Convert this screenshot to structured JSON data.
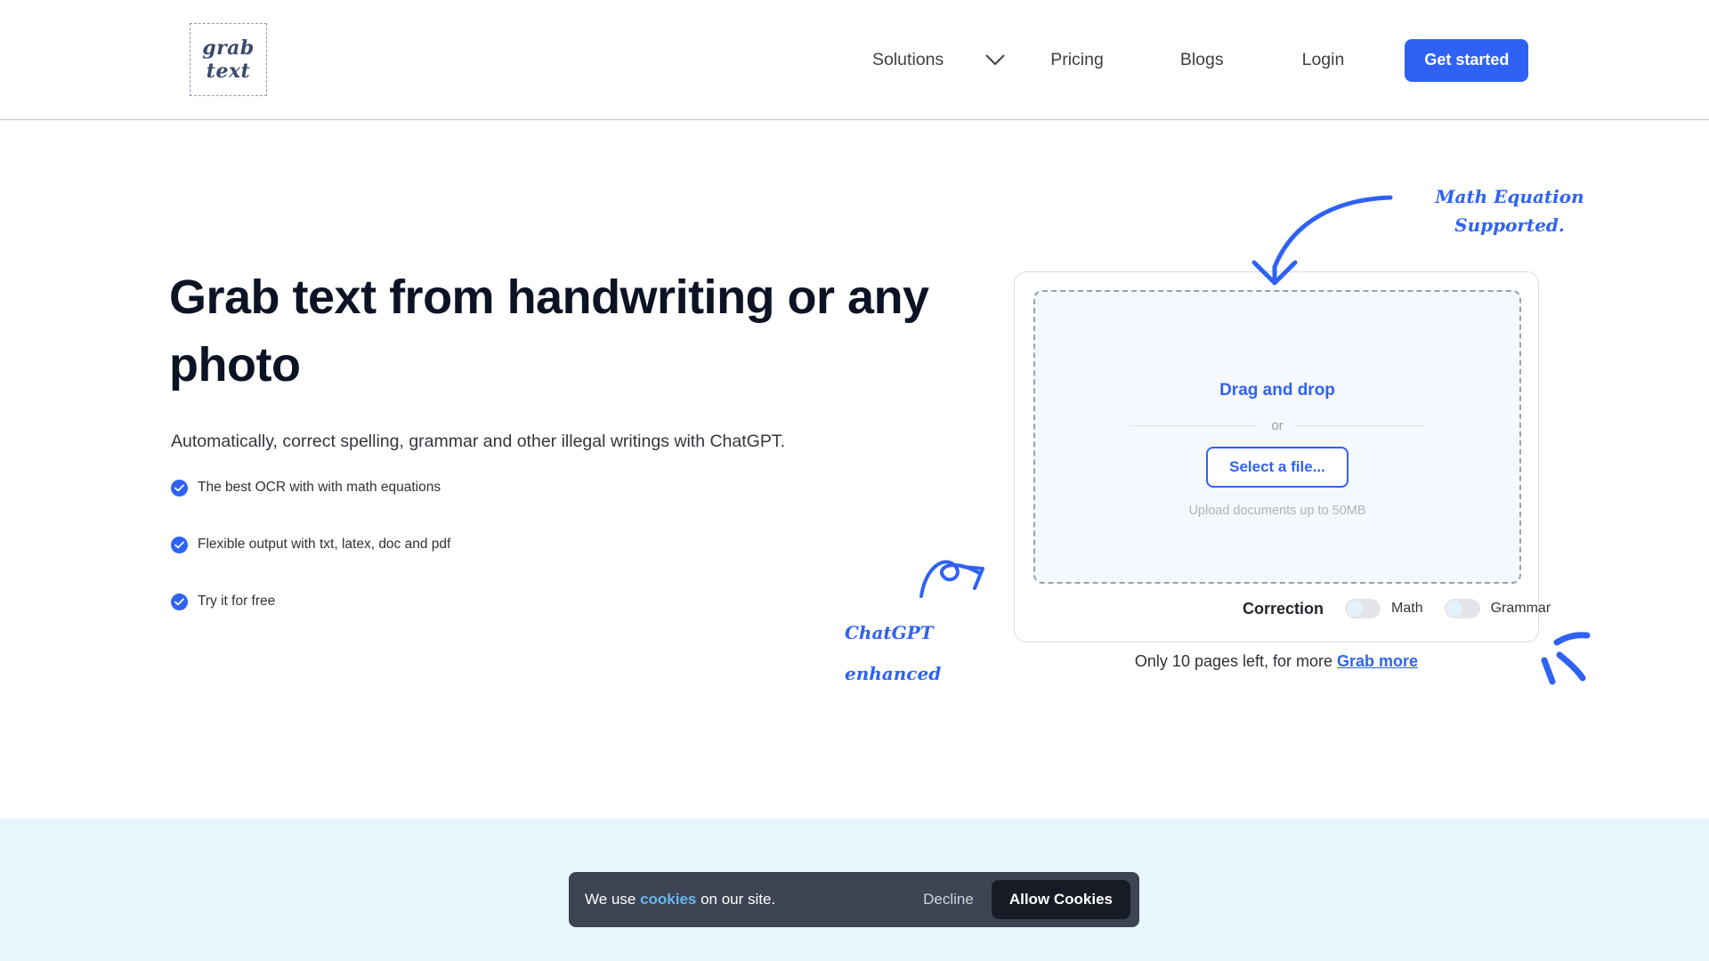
{
  "brand": {
    "logo_line1": "grab",
    "logo_line2": "text",
    "accent_blue": "#2f62f4",
    "logo_navy": "#3b4a6b"
  },
  "header": {
    "nav": {
      "solutions": "Solutions",
      "chevron_icon": "chevron-down-icon",
      "pricing": "Pricing",
      "blogs": "Blogs",
      "login": "Login"
    },
    "cta": "Get started"
  },
  "hero": {
    "title": "Grab text from handwriting or any photo",
    "subtitle": "Automatically, correct spelling, grammar and other illegal writings with ChatGPT.",
    "bullets": [
      "The best OCR with with math equations",
      "Flexible output with txt, latex, doc and pdf",
      "Try it for free"
    ]
  },
  "upload": {
    "drag_and_drop": "Drag and drop",
    "or": "or",
    "select_file": "Select a file...",
    "note": "Upload documents up to 50MB",
    "correction_label": "Correction",
    "toggles": [
      {
        "label": "Math",
        "state": "off"
      },
      {
        "label": "Grammar",
        "state": "off"
      }
    ],
    "pages_left_prefix": "Only 10 pages left, for more ",
    "grab_more": "Grab more"
  },
  "annotations": {
    "math_line1": "Math Equation",
    "math_line2": "Supported.",
    "chat_line1": "ChatGPT",
    "chat_line2": "enhanced",
    "arrow_math_icon": "curved-arrow-down-icon",
    "arrow_chat_icon": "looping-arrow-icon",
    "sparkle_icon": "sparkle-strokes-icon"
  },
  "cookie": {
    "text_prefix": "We use ",
    "link": "cookies",
    "text_suffix": " on our site.",
    "decline": "Decline",
    "allow": "Allow Cookies"
  }
}
